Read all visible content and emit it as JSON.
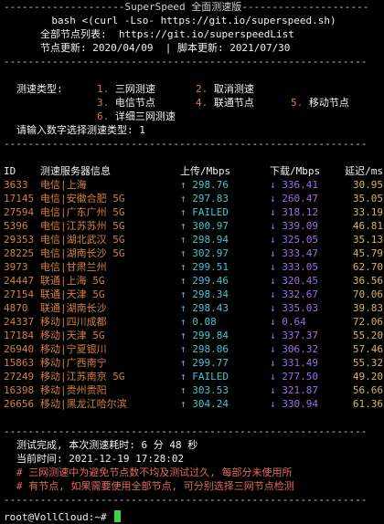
{
  "banner": {
    "title": "SuperSpeed 全面测速版",
    "command": "bash <(curl -Lso- https://git.io/superspeed.sh)",
    "node_list": "全部节点列表:  https://git.io/superspeedList",
    "update": "节点更新: 2020/04/09  | 脚本更新: 2021/07/30"
  },
  "menu": {
    "label": "测速类型:",
    "options": [
      {
        "num": "1.",
        "text": "三网测速"
      },
      {
        "num": "2.",
        "text": "取消测速"
      },
      {
        "num": "3.",
        "text": "电信节点"
      },
      {
        "num": "4.",
        "text": "联通节点"
      },
      {
        "num": "5.",
        "text": "移动节点"
      },
      {
        "num": "6.",
        "text": "详细三网测速"
      }
    ],
    "prompt": "请输入数字选择测速类型: 1"
  },
  "table": {
    "headers": {
      "id": "ID",
      "name": "测速服务器信息",
      "up": "上传/Mbps",
      "down": "下载/Mbps",
      "latency": "延迟/ms"
    },
    "rows": [
      {
        "id": "3633",
        "name": "电信|上海",
        "up": "↑ 298.76",
        "down": "↓ 336.41",
        "latency": "30.95"
      },
      {
        "id": "17145",
        "name": "电信|安徽合肥 5G",
        "up": "↑ 297.83",
        "down": "↓ 260.47",
        "latency": "35.05"
      },
      {
        "id": "27594",
        "name": "电信|广东广州 5G",
        "up": "↑ FAILED",
        "down": "↓ 318.12",
        "latency": "33.19"
      },
      {
        "id": "5396",
        "name": "电信|江苏苏州 5G",
        "up": "↑ 300.97",
        "down": "↓ 339.09",
        "latency": "46.81"
      },
      {
        "id": "29353",
        "name": "电信|湖北武汉 5G",
        "up": "↑ 298.94",
        "down": "↓ 325.05",
        "latency": "35.13"
      },
      {
        "id": "28225",
        "name": "电信|湖南长沙 5G",
        "up": "↑ 302.97",
        "down": "↓ 333.47",
        "latency": "45.79"
      },
      {
        "id": "3973",
        "name": "电信|甘肃兰州",
        "up": "↑ 299.51",
        "down": "↓ 333.05",
        "latency": "62.70"
      },
      {
        "id": "24447",
        "name": "联通|上海 5G",
        "up": "↑ 299.46",
        "down": "↓ 320.45",
        "latency": "36.56"
      },
      {
        "id": "27154",
        "name": "联通|天津 5G",
        "up": "↑ 298.34",
        "down": "↓ 332.67",
        "latency": "70.06"
      },
      {
        "id": "4870",
        "name": "联通|湖南长沙",
        "up": "↑ 298.43",
        "down": "↓ 335.03",
        "latency": "39.83"
      },
      {
        "id": "24337",
        "name": "移动|四川成都",
        "up": "↑ 0.08",
        "down": "↓ 0.64",
        "latency": "72.06"
      },
      {
        "id": "17184",
        "name": "移动|天津 5G",
        "up": "↑ 299.84",
        "down": "↓ 337.37",
        "latency": "55.20"
      },
      {
        "id": "26940",
        "name": "移动|宁夏银川",
        "up": "↑ 298.06",
        "down": "↓ 306.32",
        "latency": "57.46"
      },
      {
        "id": "15863",
        "name": "移动|广西南宁",
        "up": "↑ 299.77",
        "down": "↓ 331.49",
        "latency": "55.32"
      },
      {
        "id": "27249",
        "name": "移动|江苏南京 5G",
        "up": "↑ FAILED",
        "down": "↓ 277.50",
        "latency": "49.20"
      },
      {
        "id": "16398",
        "name": "移动|贵州贵阳",
        "up": "↑ 303.53",
        "down": "↓ 321.87",
        "latency": "56.66"
      },
      {
        "id": "26656",
        "name": "移动|黑龙江哈尔滨",
        "up": "↑ 304.24",
        "down": "↓ 330.94",
        "latency": "61.36"
      }
    ]
  },
  "footer": {
    "done": "测试完成, 本次测速耗时: 6 分 48 秒",
    "time": "当前时间: 2021-12-19 17:28:02",
    "note1": "# 三网测速中为避免节点数不均及测试过久, 每部分未使用所",
    "note2": "# 有节点, 如果需要使用全部节点, 可分别选择三网节点检测"
  },
  "prompt": "root@VollCloud:~#",
  "colors": {
    "id": "#d3813a",
    "name": "#d3813a",
    "up": "#3fc7cf",
    "down": "#9a6de0",
    "latency": "#d8b64a",
    "cursor": "#3ed14a"
  }
}
